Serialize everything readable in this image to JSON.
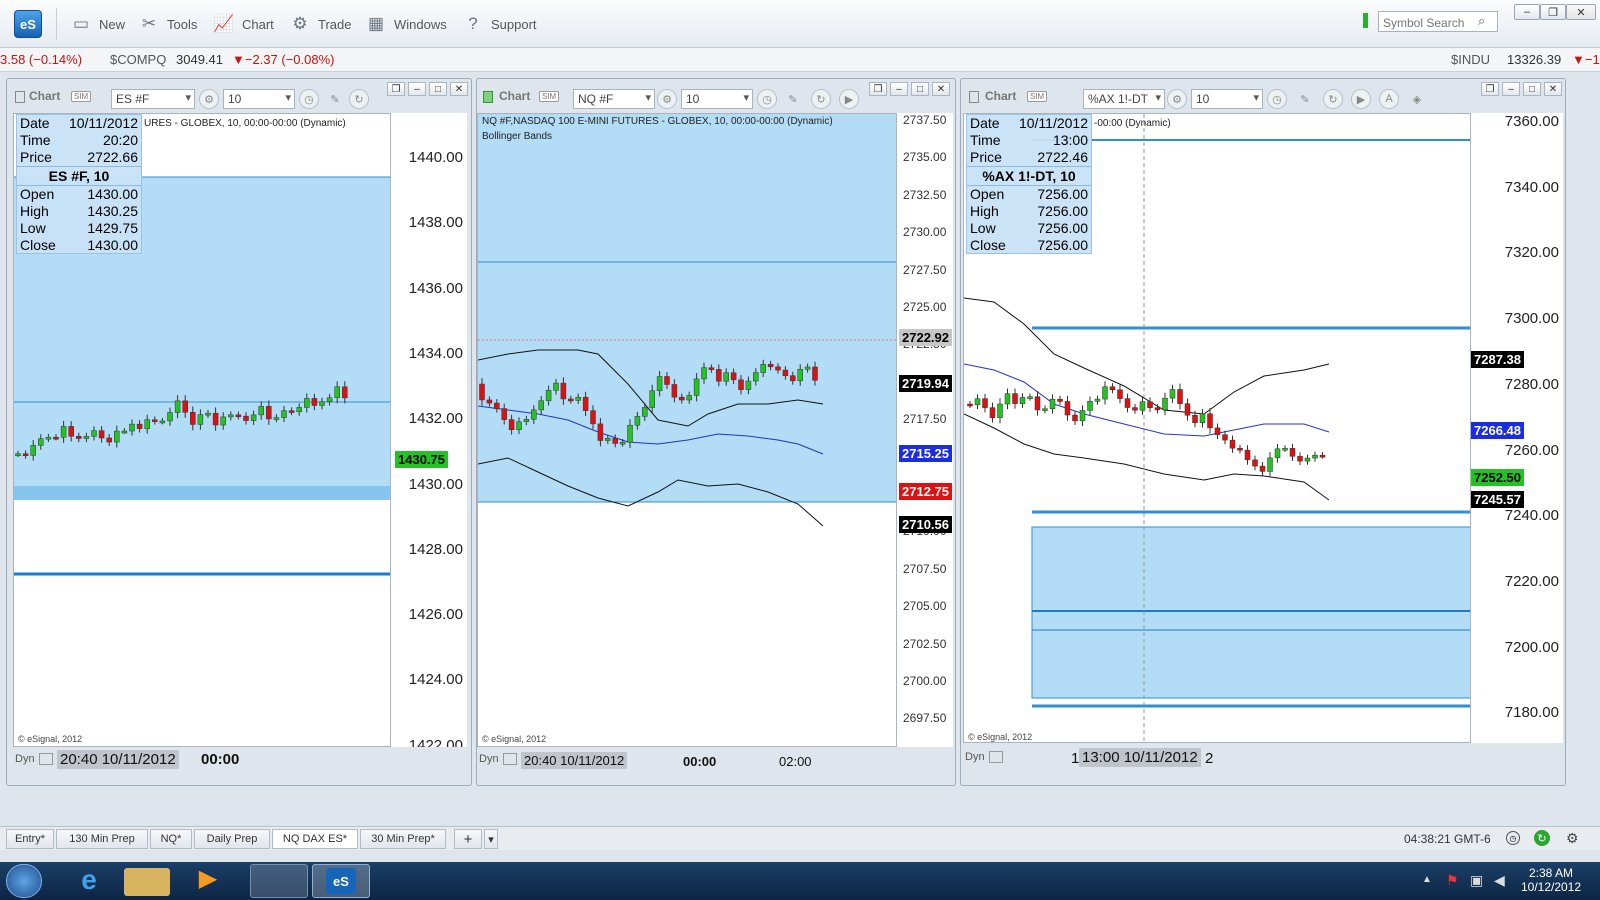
{
  "app": {
    "logo": "eS"
  },
  "toolbar": {
    "items": [
      {
        "label": "New",
        "icon": "new-window-icon"
      },
      {
        "label": "Tools",
        "icon": "tools-icon"
      },
      {
        "label": "Chart",
        "icon": "chart-icon"
      },
      {
        "label": "Trade",
        "icon": "trade-icon"
      },
      {
        "label": "Windows",
        "icon": "windows-icon"
      },
      {
        "label": "Support",
        "icon": "help-icon"
      }
    ],
    "symbol_search_placeholder": "Symbol Search"
  },
  "ticker": {
    "left_change": "3.58 (−0.14%)",
    "compq_sym": "$COMPQ",
    "compq_price": "3049.41",
    "compq_change": "▼−2.37 (−0.08%)",
    "indu_sym": "$INDU",
    "indu_price": "13326.39",
    "indu_change": "▼−1"
  },
  "windows": [
    {
      "title": "Chart",
      "sim": "SIM",
      "symbol": "ES #F",
      "interval": "10",
      "header_text": "URES - GLOBEX, 10, 00:00-00:00 (Dynamic)",
      "watermark": "© eSignal, 2012",
      "dyn": "Dyn",
      "time_highlight": "20:40 10/11/2012",
      "time_label": "00:00",
      "info": {
        "date_label": "Date",
        "date": "10/11/2012",
        "time_label": "Time",
        "time": "20:20",
        "price_label": "Price",
        "price": "2722.66",
        "heading": "ES #F, 10",
        "open_label": "Open",
        "open": "1430.00",
        "high_label": "High",
        "high": "1430.25",
        "low_label": "Low",
        "low": "1429.75",
        "close_label": "Close",
        "close": "1430.00"
      },
      "y_ticks": [
        "1440.00",
        "1438.00",
        "1436.00",
        "1434.00",
        "1432.00",
        "1430.00",
        "1428.00",
        "1426.00",
        "1424.00",
        "1422.00"
      ],
      "price_tag": "1430.75"
    },
    {
      "title": "Chart",
      "sim": "SIM",
      "symbol": "NQ #F",
      "interval": "10",
      "header_text": "NQ #F,NASDAQ 100 E-MINI FUTURES - GLOBEX, 10, 00:00-00:00 (Dynamic)",
      "study": "Bollinger Bands",
      "watermark": "© eSignal, 2012",
      "dyn": "Dyn",
      "time_highlight": "20:40 10/11/2012",
      "time_labels": [
        "00:00",
        "02:00"
      ],
      "y_ticks": [
        "2737.50",
        "2735.00",
        "2732.50",
        "2730.00",
        "2727.50",
        "2725.00",
        "2722.50",
        "2720.00",
        "2717.50",
        "2715.00",
        "2712.50",
        "2710.00",
        "2707.50",
        "2705.00",
        "2702.50",
        "2700.00",
        "2697.50"
      ],
      "tags": [
        "2722.92",
        "2719.94",
        "2715.25",
        "2712.75",
        "2710.56"
      ]
    },
    {
      "title": "Chart",
      "sim": "SIM",
      "symbol": "%AX 1!-DT",
      "interval": "10",
      "header_text": "-00:00 (Dynamic)",
      "watermark": "© eSignal, 2012",
      "dyn": "Dyn",
      "time_prefix": "1",
      "time_highlight": "13:00 10/11/2012",
      "time_suffix": "2",
      "info": {
        "date_label": "Date",
        "date": "10/11/2012",
        "time_label": "Time",
        "time": "13:00",
        "price_label": "Price",
        "price": "2722.46",
        "heading": "%AX 1!-DT, 10",
        "open_label": "Open",
        "open": "7256.00",
        "high_label": "High",
        "high": "7256.00",
        "low_label": "Low",
        "low": "7256.00",
        "close_label": "Close",
        "close": "7256.00"
      },
      "y_ticks": [
        "7360.00",
        "7340.00",
        "7320.00",
        "7300.00",
        "7280.00",
        "7260.00",
        "7240.00",
        "7220.00",
        "7200.00",
        "7180.00"
      ],
      "tags": [
        "7287.38",
        "7266.48",
        "7252.50",
        "7245.57"
      ]
    }
  ],
  "tabs": [
    "Entry*",
    "130 Min Prep",
    "NQ*",
    "Daily Prep",
    "NQ DAX ES*",
    "30 Min Prep*"
  ],
  "active_tab": "NQ DAX ES*",
  "status": {
    "clock": "04:38:21 GMT-6"
  },
  "taskbar": {
    "time": "2:38 AM",
    "date": "10/12/2012"
  },
  "colors": {
    "up": "#22c322",
    "down": "#dd1111",
    "shade": "#b3dcf7",
    "tag_blue": "#1a2ee0",
    "tag_red": "#dd1111",
    "tag_green": "#22c322"
  }
}
